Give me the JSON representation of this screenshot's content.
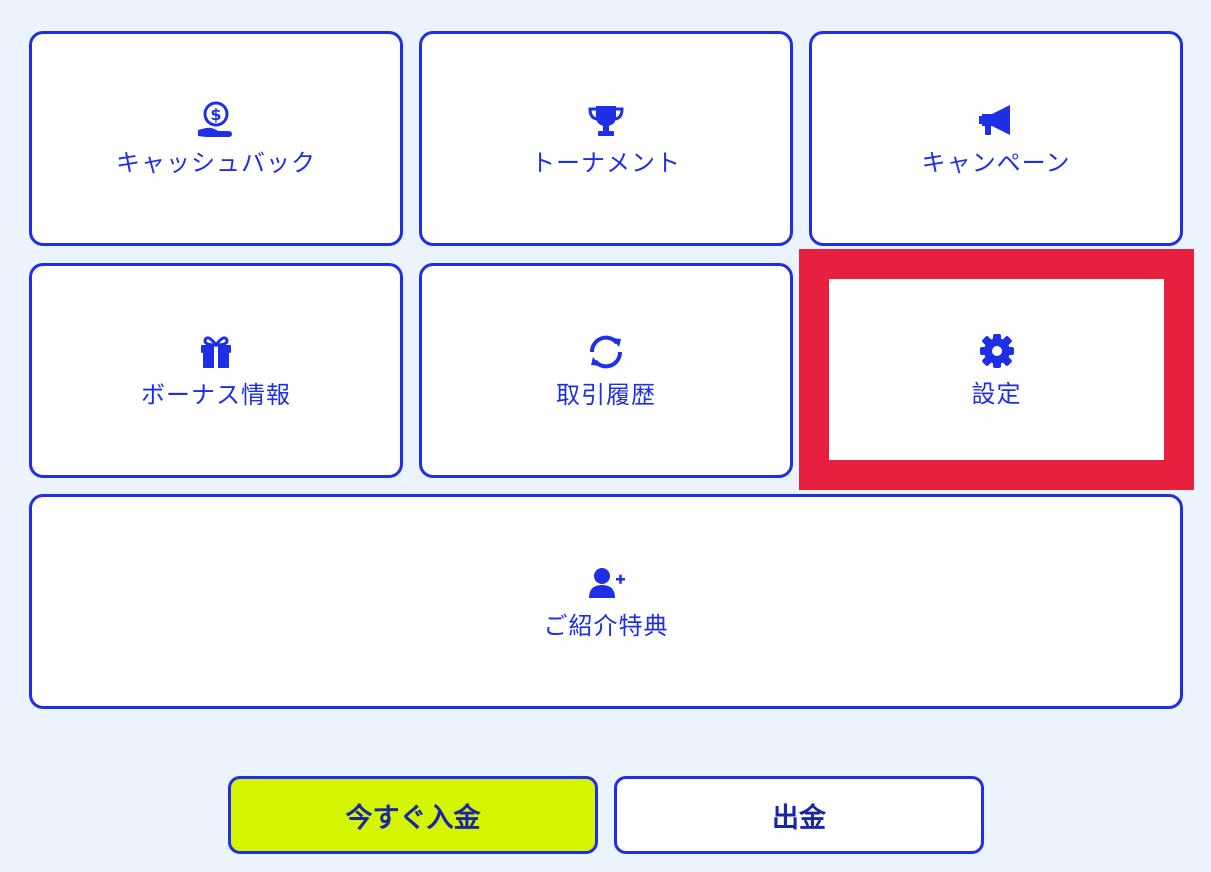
{
  "menu": {
    "tiles": [
      {
        "label": "キャッシュバック",
        "icon": "cashback-hand-icon"
      },
      {
        "label": "トーナメント",
        "icon": "trophy-icon"
      },
      {
        "label": "キャンペーン",
        "icon": "megaphone-icon"
      },
      {
        "label": "ボーナス情報",
        "icon": "gift-icon"
      },
      {
        "label": "取引履歴",
        "icon": "refresh-icon"
      },
      {
        "label": "設定",
        "icon": "gear-icon"
      },
      {
        "label": "ご紹介特典",
        "icon": "add-user-icon"
      }
    ]
  },
  "actions": {
    "deposit_label": "今すぐ入金",
    "withdraw_label": "出金"
  },
  "colors": {
    "accent": "#1f2fe6",
    "background": "#ebf4fe",
    "highlight": "#e8203f",
    "deposit_button": "#d4f400"
  }
}
